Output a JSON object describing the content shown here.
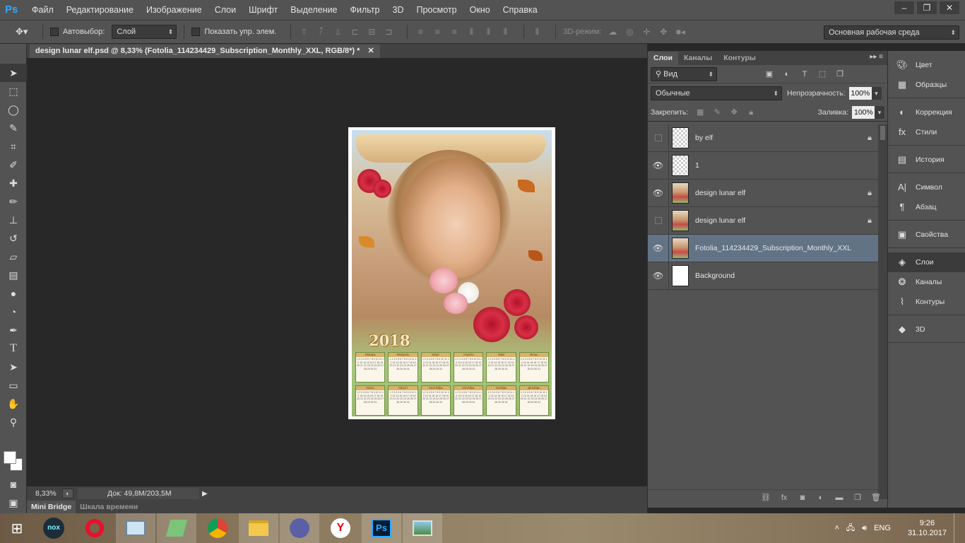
{
  "app": {
    "logo": "Ps",
    "menu": [
      "Файл",
      "Редактирование",
      "Изображение",
      "Слои",
      "Шрифт",
      "Выделение",
      "Фильтр",
      "3D",
      "Просмотр",
      "Окно",
      "Справка"
    ],
    "window_controls": [
      "minimize-icon",
      "restore-icon",
      "close-icon"
    ]
  },
  "options_bar": {
    "auto_select_label": "Автовыбор:",
    "auto_select_value": "Слой",
    "show_transform_label": "Показать упр. элем.",
    "mode_3d_label": "3D-режим:",
    "workspace_value": "Основная рабочая среда"
  },
  "document": {
    "tab_title": "design lunar elf.psd @ 8,33% (Fotolia_114234429_Subscription_Monthly_XXL, RGB/8*) *",
    "calendar_year": "2018",
    "months": [
      "Январь",
      "Февраль",
      "Март",
      "Апрель",
      "Май",
      "Июнь",
      "Июль",
      "Август",
      "Сентябрь",
      "Октябрь",
      "Ноябрь",
      "Декабрь"
    ]
  },
  "status_bar": {
    "zoom": "8,33%",
    "doc_info": "Док: 49,8M/203,5M"
  },
  "bottom_tabs": [
    "Mini Bridge",
    "Шкала времени"
  ],
  "layers_panel": {
    "tabs": [
      "Слои",
      "Каналы",
      "Контуры"
    ],
    "filter_kind": "Вид",
    "blend_mode": "Обычные",
    "opacity_label": "Непрозрачность:",
    "opacity_value": "100%",
    "lock_label": "Закрепить:",
    "fill_label": "Заливка:",
    "fill_value": "100%",
    "layers": [
      {
        "name": "by elf",
        "visible": false,
        "locked": true,
        "thumb": "transparent",
        "selected": false
      },
      {
        "name": "1",
        "visible": true,
        "locked": false,
        "thumb": "transparent",
        "selected": false
      },
      {
        "name": "design lunar elf",
        "visible": true,
        "locked": true,
        "thumb": "art",
        "selected": false
      },
      {
        "name": "design lunar elf",
        "visible": false,
        "locked": true,
        "thumb": "art",
        "selected": false
      },
      {
        "name": "Fotolia_114234429_Subscription_Monthly_XXL",
        "visible": true,
        "locked": false,
        "thumb": "art",
        "selected": true
      },
      {
        "name": "Background",
        "visible": true,
        "locked": false,
        "thumb": "white",
        "selected": false
      }
    ]
  },
  "dock": {
    "groups": [
      [
        {
          "label": "Цвет",
          "icon": "palette-icon"
        },
        {
          "label": "Образцы",
          "icon": "swatches-icon"
        }
      ],
      [
        {
          "label": "Коррекция",
          "icon": "adjustments-icon"
        },
        {
          "label": "Стили",
          "icon": "fx-styles-icon"
        }
      ],
      [
        {
          "label": "История",
          "icon": "history-icon"
        }
      ],
      [
        {
          "label": "Символ",
          "icon": "character-icon"
        },
        {
          "label": "Абзац",
          "icon": "paragraph-icon"
        }
      ],
      [
        {
          "label": "Свойства",
          "icon": "properties-icon"
        }
      ],
      [
        {
          "label": "Слои",
          "icon": "layers-icon",
          "active": true
        },
        {
          "label": "Каналы",
          "icon": "channels-icon"
        },
        {
          "label": "Контуры",
          "icon": "paths-icon"
        }
      ],
      [
        {
          "label": "3D",
          "icon": "3d-icon"
        }
      ]
    ]
  },
  "taskbar": {
    "apps": [
      "windows-start-icon",
      "nox-icon",
      "opera-icon",
      "monitor-app-icon",
      "notes-app-icon",
      "chrome-icon",
      "explorer-icon",
      "torrent-icon",
      "yandex-icon",
      "photoshop-icon",
      "image-viewer-icon"
    ],
    "nox_label": "nox",
    "yandex_label": "Y",
    "photoshop_label": "Ps",
    "language": "ENG",
    "time": "9:26",
    "date": "31.10.2017"
  }
}
